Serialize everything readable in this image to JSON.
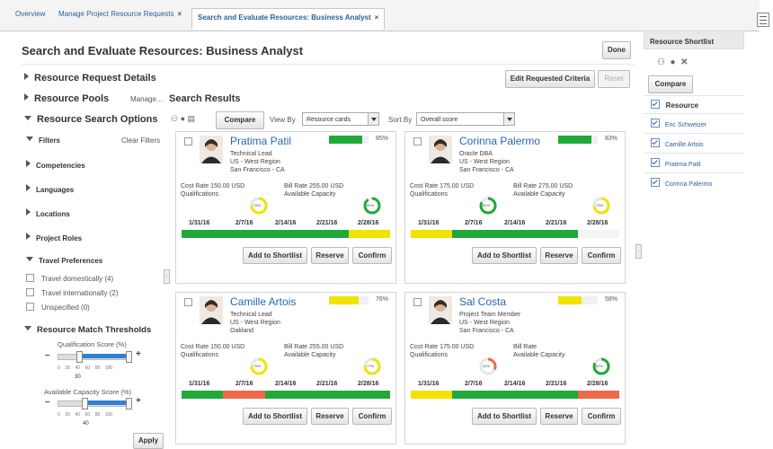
{
  "tabs": [
    {
      "label": "Overview",
      "active": false,
      "closable": false
    },
    {
      "label": "Manage Project Resource Requests",
      "active": false,
      "closable": true
    },
    {
      "label": "Search and Evaluate Resources: Business Analyst",
      "active": true,
      "closable": true
    }
  ],
  "close_glyph": "×",
  "page_title": "Search and Evaluate Resources: Business Analyst",
  "done_label": "Done",
  "edit_criteria_label": "Edit Requested Criteria",
  "reset_label": "Reset",
  "left": {
    "resource_request_details": "Resource Request Details",
    "resource_pools": "Resource Pools",
    "manage_link": "Manage...",
    "resource_search_options": "Resource Search Options",
    "filters": "Filters",
    "clear_filters": "Clear Filters",
    "filter_groups": [
      "Competencies",
      "Languages",
      "Locations",
      "Project Roles"
    ],
    "travel_preferences": "Travel Preferences",
    "travel_options": [
      "Travel domestically (4)",
      "Travel internationally (2)",
      "Unspecified (0)"
    ],
    "thresholds_title": "Resource Match Thresholds",
    "qualification_label": "Qualification Score (%)",
    "qualification_value": "30",
    "capacity_label": "Available Capacity Score (%)",
    "capacity_value": "40",
    "tick_labels": [
      "0",
      "20",
      "40",
      "60",
      "80",
      "100"
    ],
    "apply_label": "Apply"
  },
  "results": {
    "title": "Search Results",
    "compare_label": "Compare",
    "view_by_label": "View By",
    "view_by_value": "Resource cards",
    "sort_by_label": "Sort By",
    "sort_by_value": "Overall score",
    "dates": [
      "1/31/16",
      "2/7/16",
      "2/14/16",
      "2/21/16",
      "2/28/16"
    ],
    "labels": {
      "cost_rate": "Cost Rate",
      "bill_rate": "Bill Rate",
      "qualifications": "Qualifications",
      "available_capacity": "Available Capacity",
      "add_to_shortlist": "Add to Shortlist",
      "reserve": "Reserve",
      "confirm": "Confirm"
    },
    "cards": [
      {
        "name": "Pratima Patil",
        "role": "Technical Lead",
        "region": "US - West Region",
        "city": "San Francisco - CA",
        "score": "85%",
        "score_value": 85,
        "score_color": "#22a83a",
        "cost": "150.00 USD",
        "bill": "255.00 USD",
        "qual": "75%",
        "qual_value": 75,
        "qual_color": "#f0e300",
        "cap": "90%",
        "cap_value": 90,
        "cap_color": "#22a83a",
        "timeline": [
          "#22a83a",
          "#22a83a",
          "#22a83a",
          "#22a83a",
          "#f0e300"
        ]
      },
      {
        "name": "Corinna Palermo",
        "role": "Oracle DBA",
        "region": "US - West Region",
        "city": "San Francisco - CA",
        "score": "83%",
        "score_value": 83,
        "score_color": "#22a83a",
        "cost": "175.00 USD",
        "bill": "275.00 USD",
        "qual": "82%",
        "qual_value": 82,
        "qual_color": "#22a83a",
        "cap": "73%",
        "cap_value": 73,
        "cap_color": "#f0e300",
        "timeline": [
          "#f0e300",
          "#22a83a",
          "#22a83a",
          "#22a83a",
          "#f4f4f4"
        ]
      },
      {
        "name": "Camille Artois",
        "role": "Technical Lead",
        "region": "US - West Region",
        "city": "Oakland",
        "score": "76%",
        "score_value": 76,
        "score_color": "#f0e300",
        "cost": "150.00 USD",
        "bill": "255.00 USD",
        "qual": "75%",
        "qual_value": 75,
        "qual_color": "#f0e300",
        "cap": "77%",
        "cap_value": 77,
        "cap_color": "#f0e300",
        "timeline": [
          "#22a83a",
          "#ef6a4a",
          "#22a83a",
          "#22a83a",
          "#22a83a"
        ]
      },
      {
        "name": "Sal Costa",
        "role": "Project Team Member",
        "region": "US - West Region",
        "city": "San Francisco - CA",
        "score": "58%",
        "score_value": 58,
        "score_color": "#f0e300",
        "cost": "175.00 USD",
        "bill": "",
        "qual": "32%",
        "qual_value": 32,
        "qual_color": "#ef6a4a",
        "cap": "82%",
        "cap_value": 82,
        "cap_color": "#22a83a",
        "timeline": [
          "#f0e300",
          "#22a83a",
          "#22a83a",
          "#22a83a",
          "#ef6a4a"
        ]
      }
    ]
  },
  "shortlist": {
    "title": "Resource Shortlist",
    "compare_label": "Compare",
    "header": "Resource",
    "items": [
      "Eric Schweizer",
      "Camille Artois",
      "Pratima Patil",
      "Corinna Palermo"
    ]
  }
}
